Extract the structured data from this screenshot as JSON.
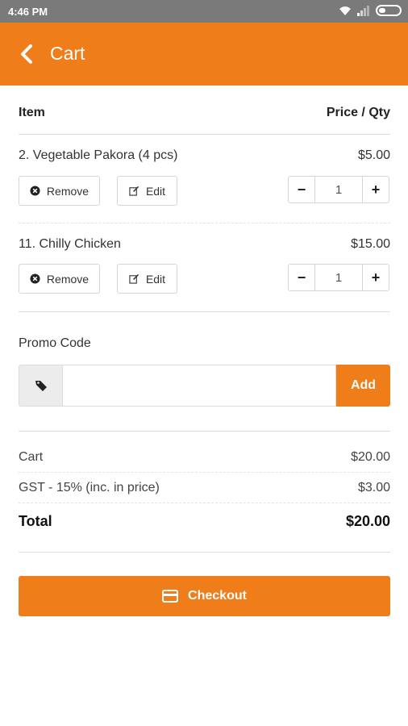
{
  "status_bar": {
    "time": "4:46 PM"
  },
  "app_bar": {
    "title": "Cart",
    "back_icon": "chevron-left-icon"
  },
  "columns": {
    "item": "Item",
    "price_qty": "Price / Qty"
  },
  "items": [
    {
      "name": "2. Vegetable Pakora (4 pcs)",
      "price": "$5.00",
      "qty": "1",
      "remove_label": "Remove",
      "edit_label": "Edit"
    },
    {
      "name": "11. Chilly Chicken",
      "price": "$15.00",
      "qty": "1",
      "remove_label": "Remove",
      "edit_label": "Edit"
    }
  ],
  "qty_controls": {
    "minus": "−",
    "plus": "+"
  },
  "promo": {
    "label": "Promo Code",
    "value": "",
    "add_label": "Add",
    "icon": "tag-icon"
  },
  "summary": {
    "cart_label": "Cart",
    "cart_value": "$20.00",
    "gst_label": "GST - 15% (inc. in price)",
    "gst_value": "$3.00",
    "total_label": "Total",
    "total_value": "$20.00"
  },
  "checkout": {
    "label": "Checkout",
    "icon": "credit-card-icon"
  },
  "colors": {
    "accent": "#ef7d1a",
    "status_bar": "#7a7a7a"
  }
}
